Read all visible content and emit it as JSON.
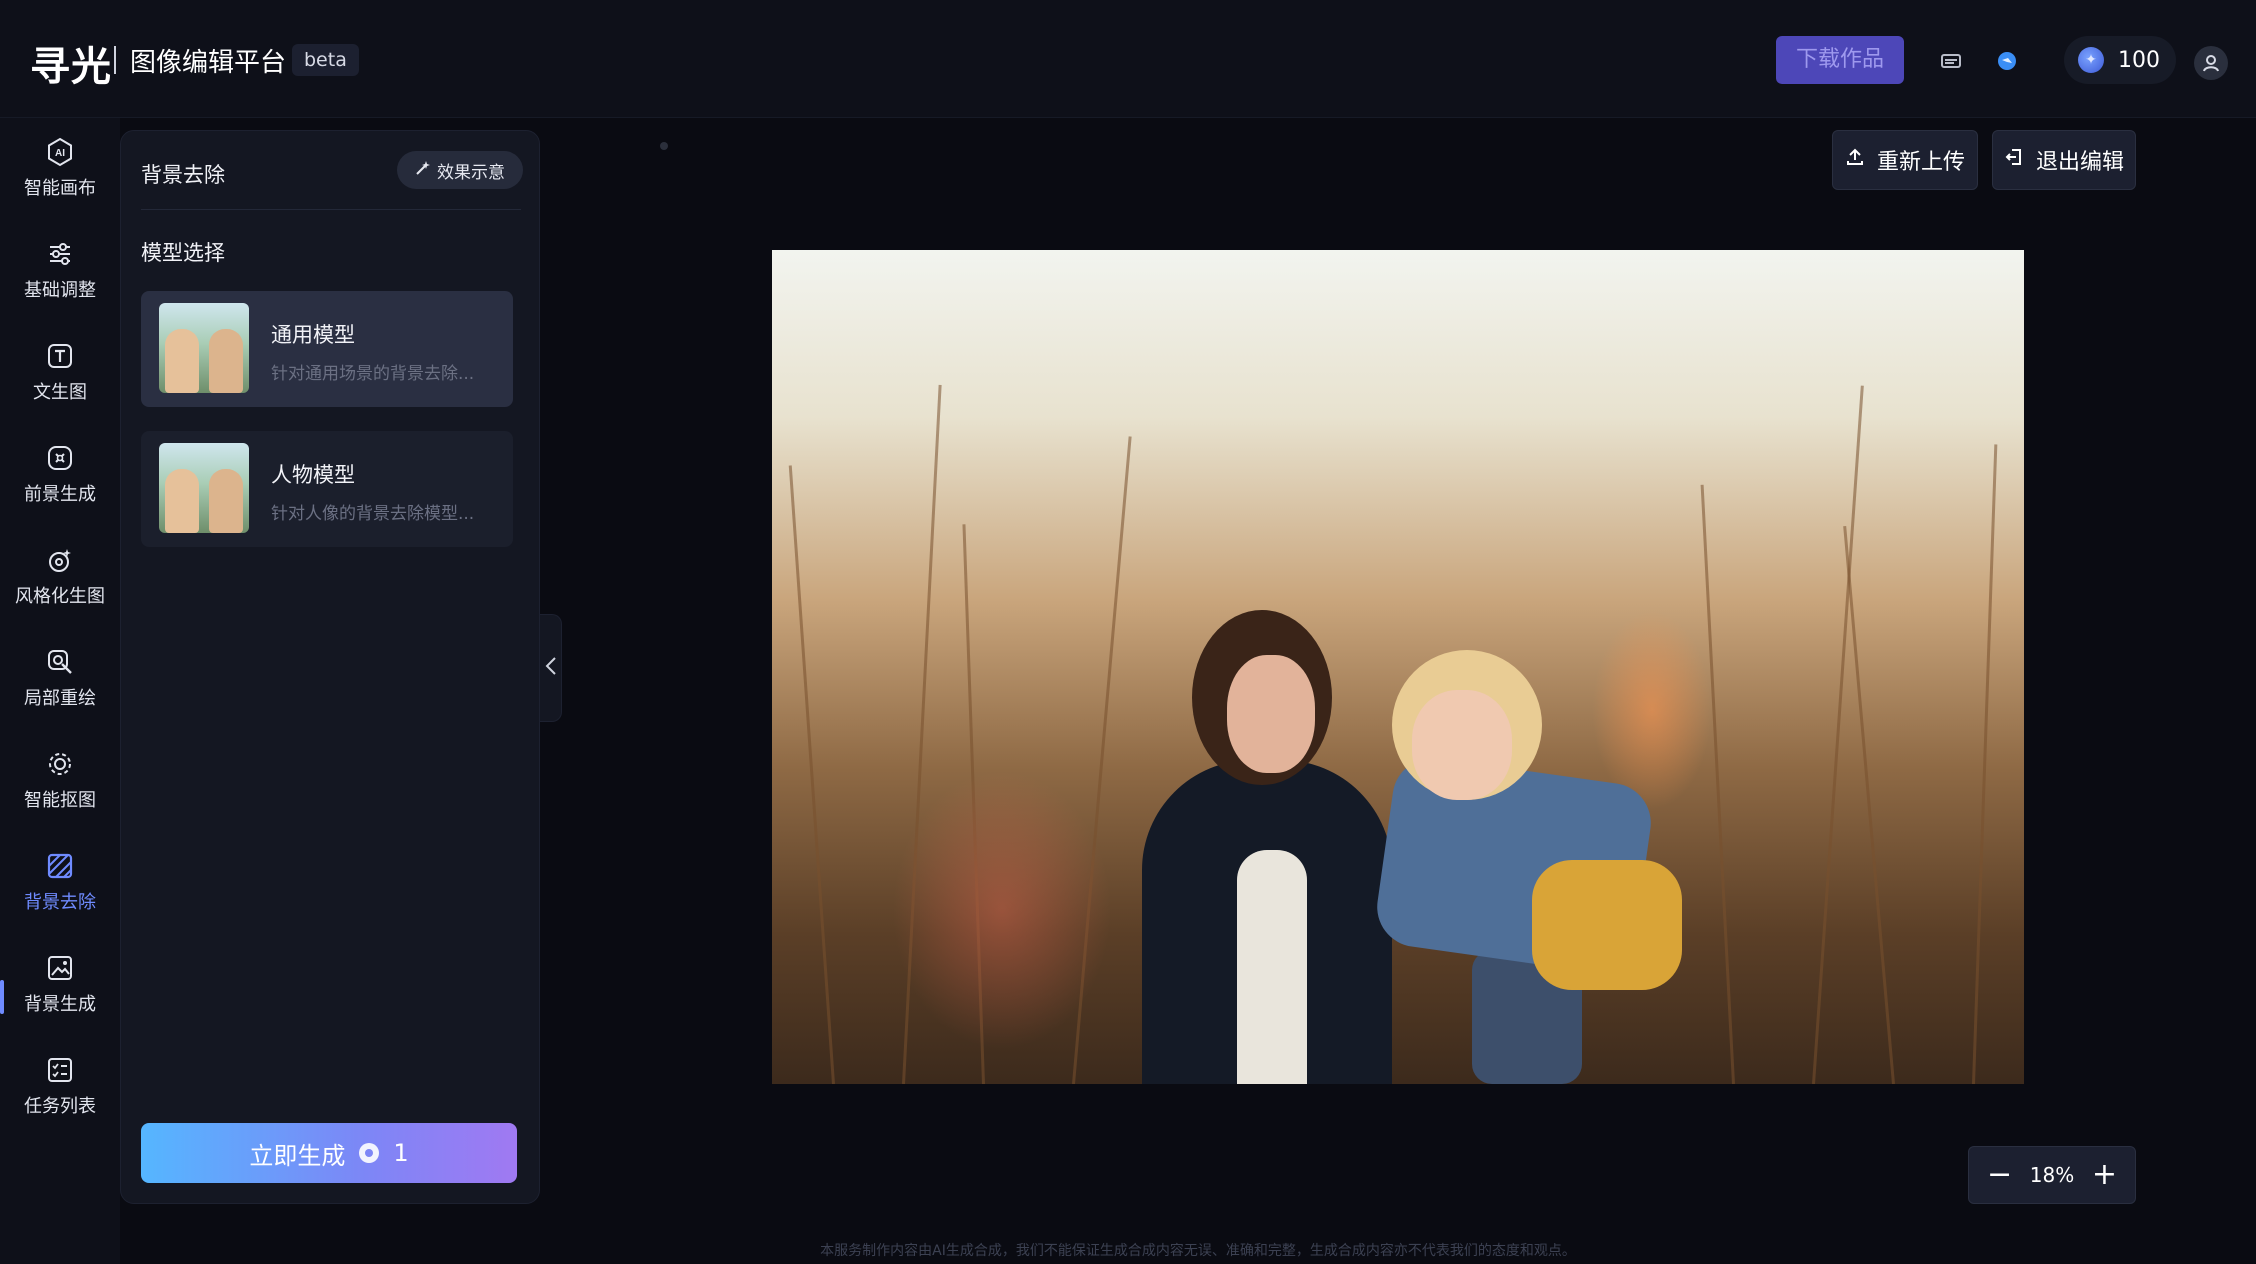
{
  "header": {
    "logo": "寻光",
    "app_name": "图像编辑平台",
    "badge": "beta",
    "download_label": "下载作品",
    "credits": "100"
  },
  "rail": {
    "items": [
      {
        "label": "智能画布",
        "icon": "ai-icon"
      },
      {
        "label": "基础调整",
        "icon": "sliders-icon"
      },
      {
        "label": "文生图",
        "icon": "text-t-icon"
      },
      {
        "label": "前景生成",
        "icon": "foreground-icon"
      },
      {
        "label": "风格化生图",
        "icon": "style-icon"
      },
      {
        "label": "局部重绘",
        "icon": "local-repaint-icon"
      },
      {
        "label": "智能抠图",
        "icon": "smart-cutout-icon"
      },
      {
        "label": "背景去除",
        "icon": "background-remove-icon"
      },
      {
        "label": "背景生成",
        "icon": "background-generate-icon"
      },
      {
        "label": "任务列表",
        "icon": "task-list-icon"
      }
    ],
    "active_index": 7
  },
  "panel": {
    "title": "背景去除",
    "demo_label": "效果示意",
    "section_label": "模型选择",
    "models": [
      {
        "name": "通用模型",
        "desc": "针对通用场景的背景去除..."
      },
      {
        "name": "人物模型",
        "desc": "针对人像的背景去除模型..."
      }
    ],
    "selected_model": 0,
    "generate_label": "立即生成",
    "generate_cost": "1"
  },
  "canvas": {
    "reupload_label": "重新上传",
    "exit_label": "退出编辑",
    "zoom_value": "18%",
    "zoom_out": "−",
    "zoom_in": "+"
  },
  "footer": {
    "note": "本服务制作内容由AI生成合成，我们不能保证生成合成内容无误、准确和完整，生成合成内容亦不代表我们的态度和观点。"
  },
  "colors": {
    "accent": "#6f8bff",
    "download_bg": "#4d47b8",
    "generate_start": "#55b6ff",
    "generate_end": "#a079f2"
  }
}
